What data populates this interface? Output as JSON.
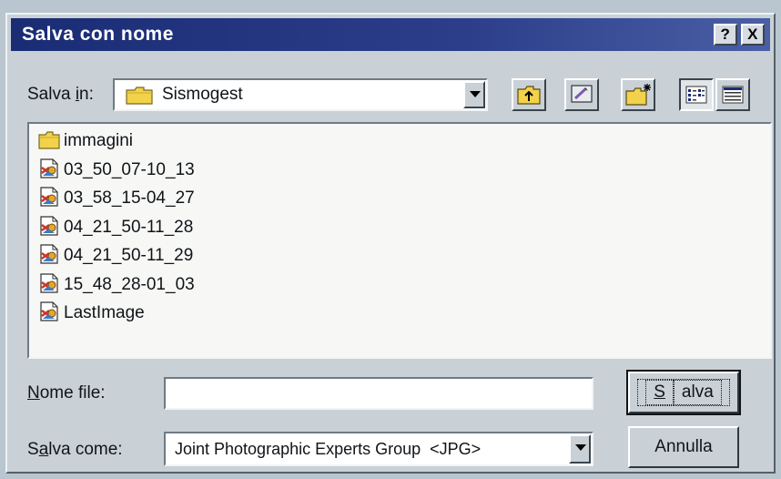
{
  "window": {
    "title": "Salva con nome",
    "help_button": "?",
    "close_button": "X"
  },
  "location": {
    "label_prefix": "Salva ",
    "label_accel": "i",
    "label_suffix": "n:",
    "current_folder": "Sismogest",
    "folder_icon": "folder-icon"
  },
  "toolbar": {
    "buttons": [
      {
        "name": "up-one-level-button",
        "icon": "up-folder-icon"
      },
      {
        "name": "desktop-button",
        "icon": "desktop-icon"
      },
      {
        "name": "new-folder-button",
        "icon": "new-folder-icon"
      },
      {
        "name": "list-view-button",
        "icon": "list-view-icon",
        "pressed": true
      },
      {
        "name": "details-view-button",
        "icon": "details-view-icon"
      }
    ]
  },
  "files": [
    {
      "name": "immagini",
      "type": "folder",
      "icon": "folder-icon"
    },
    {
      "name": "03_50_07-10_13",
      "type": "image",
      "icon": "image-file-icon"
    },
    {
      "name": "03_58_15-04_27",
      "type": "image",
      "icon": "image-file-icon"
    },
    {
      "name": "04_21_50-11_28",
      "type": "image",
      "icon": "image-file-icon"
    },
    {
      "name": "04_21_50-11_29",
      "type": "image",
      "icon": "image-file-icon"
    },
    {
      "name": "15_48_28-01_03",
      "type": "image",
      "icon": "image-file-icon"
    },
    {
      "name": "LastImage",
      "type": "image",
      "icon": "image-file-icon"
    }
  ],
  "filename": {
    "label_accel": "N",
    "label_rest": "ome file:",
    "value": ""
  },
  "filetype": {
    "label_prefix": "S",
    "label_accel": "a",
    "label_rest": "lva come:",
    "selected": "Joint Photographic Experts Group  <JPG>"
  },
  "buttons": {
    "save_accel": "S",
    "save_rest": "alva",
    "cancel": "Annulla"
  },
  "colors": {
    "titlebar": "#1a2c74",
    "dialog_face": "#c9d1d7",
    "folder_yellow": "#f2d24a"
  }
}
